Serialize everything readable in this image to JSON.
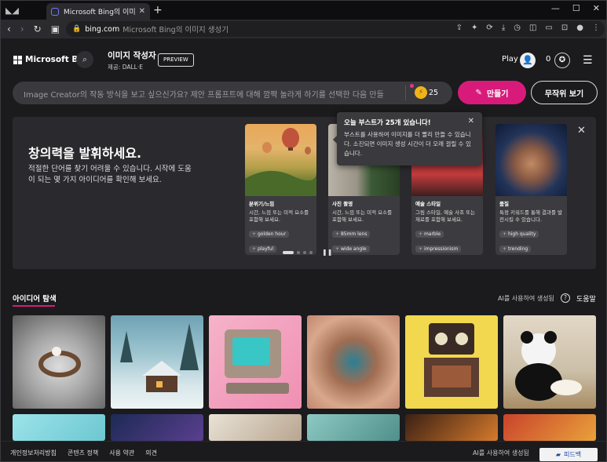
{
  "browser": {
    "tab_title": "Microsoft Bing의 이미지 생성",
    "new_tab_glyph": "+",
    "url_host": "bing.com",
    "url_path": "Microsoft Bing의 이미지 생성기"
  },
  "header": {
    "brand": "Microsoft Bing",
    "product_name": "이미지 작성자",
    "product_sub": "제공: DALL·E",
    "preview_badge": "PREVIEW",
    "play_label": "Play",
    "rewards_count": "0"
  },
  "prompt": {
    "placeholder": "Image Creator의 작동 방식을 보고 싶으신가요? 제안 프롬프트에 대해 깜짝 놀라게 하기를 선택한 다음 만들",
    "boost_count": "25",
    "create_label": "만들기",
    "surprise_label": "무작위 보기"
  },
  "hero": {
    "title": "창의력을 발휘하세요.",
    "desc": "적절한 단어를 찾기 어려울 수 있습니다. 시작에 도움이 되는 몇 가지 아이디어를 확인해 보세요.",
    "cards": [
      {
        "title": "분위기/느낌",
        "desc": "시간, 느낌 또는 미적 요소를 포함해 보세요.",
        "chips": [
          "golden hour",
          "playful"
        ]
      },
      {
        "title": "사진 촬영",
        "desc": "시간, 느낌 또는 미적 요소를 포함해 보세요.",
        "chips": [
          "85mm lens",
          "wide angle"
        ]
      },
      {
        "title": "예술 스타일",
        "desc": "그림 스타일, 예술 사조 또는 재료를 포함해 보세요.",
        "chips": [
          "marble",
          "impressionism"
        ]
      },
      {
        "title": "품질",
        "desc": "특정 키워드를 통해 결과를 발전시킬 수 있습니다.",
        "chips": [
          "high quality",
          "trending"
        ]
      }
    ]
  },
  "tooltip": {
    "title": "오늘 부스트가 25개 있습니다!",
    "desc": "부스트를 사용하여 이미지를 더 빨리 만들 수 있습니다. 소진되면 이미지 생성 시간이 더 오래 걸릴 수 있습니다."
  },
  "explore": {
    "title": "아이디어 탐색",
    "ai_note": "AI를 사용하여 생성됨",
    "help": "도움말"
  },
  "footer": {
    "links": [
      "개인정보처리방침",
      "콘텐츠 정책",
      "사용 약관",
      "의견"
    ],
    "ai_note": "AI를 사용하여 생성됨",
    "feedback": "피드백"
  },
  "colors": {
    "accent": "#d81b7b",
    "background": "#1b1a1d"
  }
}
